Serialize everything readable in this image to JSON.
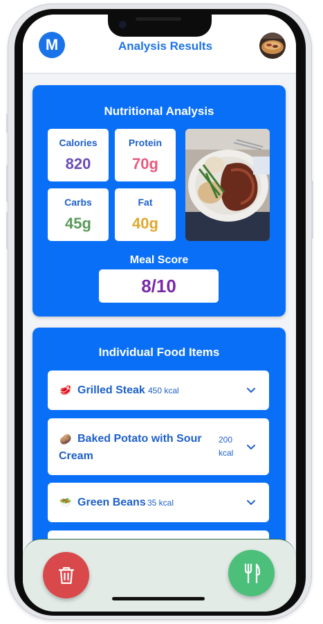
{
  "header": {
    "logo_letter": "M",
    "title": "Analysis Results"
  },
  "nutrition": {
    "title": "Nutritional Analysis",
    "macros": [
      {
        "label": "Calories",
        "value": "820",
        "color": "#6b4bb8"
      },
      {
        "label": "Protein",
        "value": "70g",
        "color": "#e85a7c"
      },
      {
        "label": "Carbs",
        "value": "45g",
        "color": "#5a9a5a"
      },
      {
        "label": "Fat",
        "value": "40g",
        "color": "#e0a830"
      }
    ],
    "score_label": "Meal Score",
    "score_value": "8/10"
  },
  "foods": {
    "title": "Individual Food Items",
    "items": [
      {
        "emoji": "🥩",
        "name": "Grilled Steak",
        "kcal": "450 kcal"
      },
      {
        "emoji": "🥔",
        "name_line1": "Baked Potato with Sour",
        "name_line2": "Cream",
        "kcal_line1": "200",
        "kcal_line2": "kcal"
      },
      {
        "emoji": "🥗",
        "name": "Green Beans",
        "kcal": "35 kcal"
      }
    ]
  },
  "actions": {
    "delete_color": "#d9484b",
    "meal_color": "#4cc07a"
  },
  "colors": {
    "accent": "#0a6ff7",
    "title_blue": "#1e73e8"
  }
}
